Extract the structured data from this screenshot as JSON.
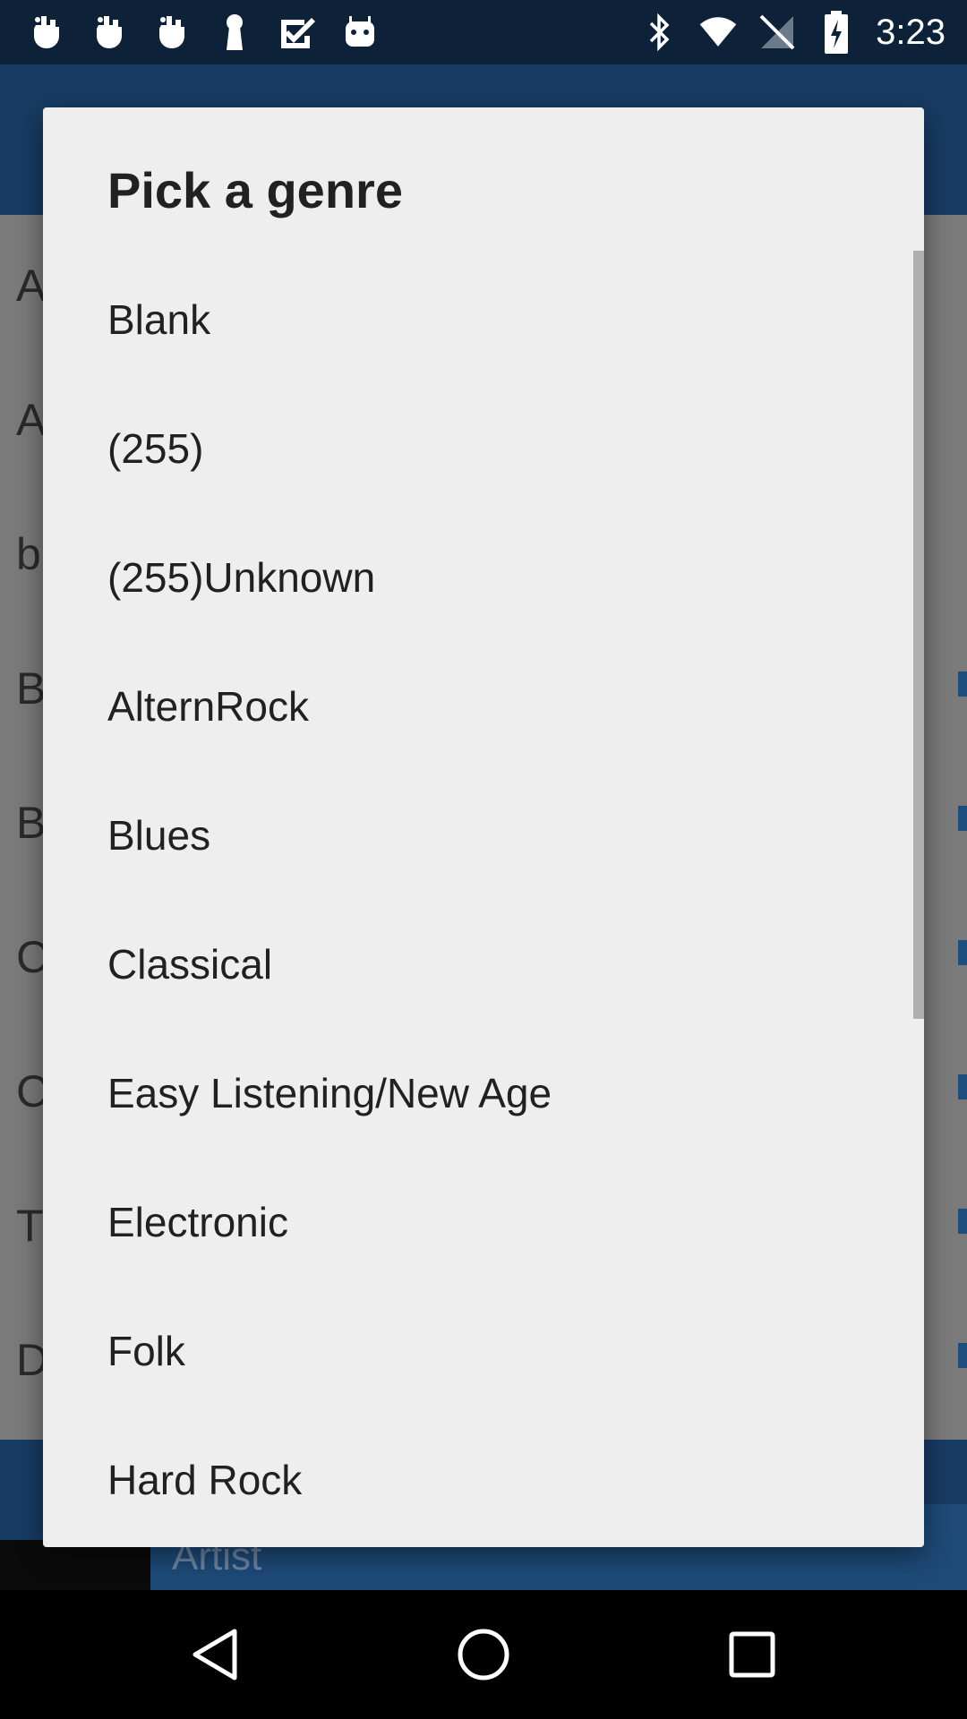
{
  "status_bar": {
    "time": "3:23",
    "left_icons": [
      "hand-icon",
      "hand-icon",
      "hand-icon",
      "keyhole-icon",
      "check-box-icon",
      "android-icon"
    ],
    "right_icons": [
      "bluetooth-icon",
      "wifi-icon",
      "no-signal-icon",
      "battery-charging-icon"
    ]
  },
  "background": {
    "letters": [
      "A",
      "A",
      "b",
      "B",
      "B",
      "C",
      "C",
      "T",
      "D"
    ],
    "artist_placeholder": "Artist"
  },
  "dialog": {
    "title": "Pick a genre",
    "items": [
      "Blank",
      "(255)",
      "(255)Unknown",
      "AlternRock",
      "Blues",
      "Classical",
      "Easy Listening/New Age",
      "Electronic",
      "Folk",
      "Hard Rock"
    ]
  },
  "nav_bar": {
    "buttons": [
      "back-icon",
      "home-icon",
      "recents-icon"
    ]
  },
  "colors": {
    "status_bar": "#0d2238",
    "app_header": "#173b63",
    "dialog_bg": "#eeeeee",
    "text_primary": "#212121"
  }
}
